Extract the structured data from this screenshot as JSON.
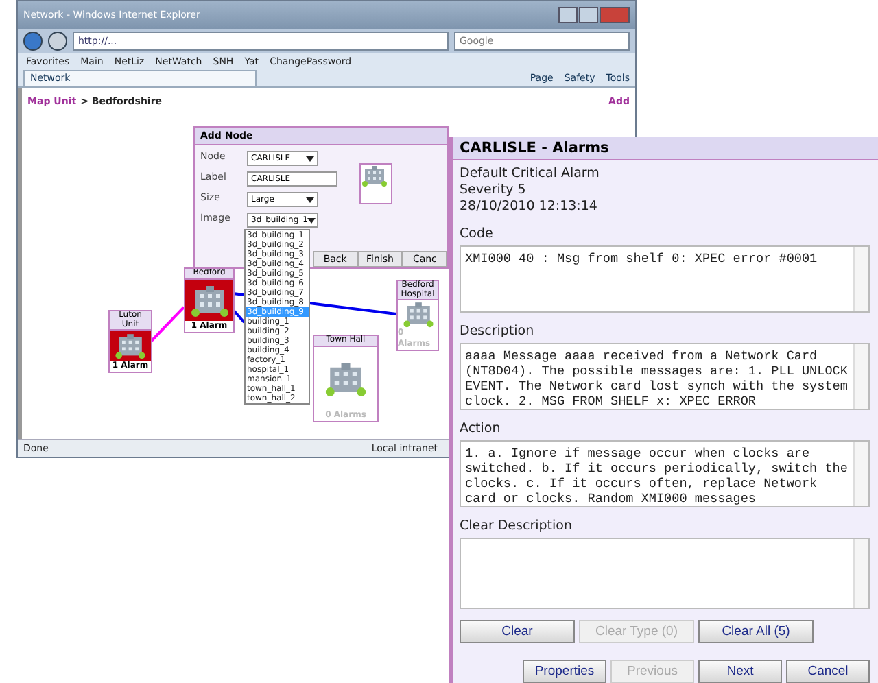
{
  "browser": {
    "title": "Network - Windows Internet Explorer",
    "address": "http://...",
    "search_placeholder": "Google",
    "favorites": [
      "Favorites",
      "Main",
      "NetLiz",
      "NetWatch",
      "SNH",
      "Yat",
      "ChangePassword"
    ],
    "tab": "Network",
    "commands": [
      "Page",
      "Safety",
      "Tools"
    ],
    "status": "Done",
    "zone": "Local intranet"
  },
  "page": {
    "breadcrumb_link": "Map Unit",
    "breadcrumb_current": "> Bedfordshire",
    "add_link": "Add"
  },
  "map": {
    "nodes": [
      {
        "label": "Bedford",
        "alarms": "1 Alarm",
        "alarmed": true,
        "kind": "large"
      },
      {
        "label": "Luton Unit",
        "alarms": "1 Alarm",
        "alarmed": true,
        "kind": "small"
      },
      {
        "label": "Town Hall",
        "alarms": "0 Alarms",
        "alarmed": false,
        "kind": "wide"
      },
      {
        "label": "Bedford Hospital",
        "alarms": "0 Alarms",
        "alarmed": false,
        "kind": "tall"
      }
    ]
  },
  "add_node": {
    "title": "Add Node",
    "fields": [
      {
        "label": "Node",
        "value": "CARLISLE",
        "kind": "select"
      },
      {
        "label": "Label",
        "value": "CARLISLE",
        "kind": "text"
      },
      {
        "label": "Size",
        "value": "Large",
        "kind": "select"
      },
      {
        "label": "Image",
        "value": "3d_building_1",
        "kind": "select"
      }
    ],
    "options": [
      {
        "text": "3d_building_1",
        "selected": false
      },
      {
        "text": "3d_building_2",
        "selected": false
      },
      {
        "text": "3d_building_3",
        "selected": false
      },
      {
        "text": "3d_building_4",
        "selected": false
      },
      {
        "text": "3d_building_5",
        "selected": false
      },
      {
        "text": "3d_building_6",
        "selected": false
      },
      {
        "text": "3d_building_7",
        "selected": false
      },
      {
        "text": "3d_building_8",
        "selected": false
      },
      {
        "text": "3d_building_9",
        "selected": true
      },
      {
        "text": "building_1",
        "selected": false
      },
      {
        "text": "building_2",
        "selected": false
      },
      {
        "text": "building_3",
        "selected": false
      },
      {
        "text": "building_4",
        "selected": false
      },
      {
        "text": "factory_1",
        "selected": false
      },
      {
        "text": "hospital_1",
        "selected": false
      },
      {
        "text": "mansion_1",
        "selected": false
      },
      {
        "text": "town_hall_1",
        "selected": false
      },
      {
        "text": "town_hall_2",
        "selected": false
      }
    ],
    "buttons": [
      "Back",
      "Finish",
      "Canc"
    ]
  },
  "alarms": {
    "title": "CARLISLE - Alarms",
    "info": [
      "Default Critical Alarm",
      "Severity 5",
      "28/10/2010 12:13:14"
    ],
    "sections": [
      {
        "label": "Code",
        "text": "XMI000 40 : Msg from shelf 0: XPEC error #0001"
      },
      {
        "label": "Description",
        "text": "aaaa Message aaaa received from a Network Card (NT8D04). The possible messages are: 1. PLL UNLOCK EVENT. The Network card lost synch with the system clock. 2. MSG FROM SHELF x: XPEC ERROR"
      },
      {
        "label": "Action",
        "text": "1. a. Ignore if message occur when clocks are switched. b. If it occurs periodically, switch the clocks. c. If it occurs often, replace Network card or clocks. Random XMI000 messages"
      },
      {
        "label": "Clear Description"
      }
    ],
    "clear_buttons": [
      {
        "label": "Clear",
        "disabled": false
      },
      {
        "label": "Clear Type (0)",
        "disabled": true
      },
      {
        "label": "Clear All (5)",
        "disabled": false
      }
    ],
    "nav_buttons": [
      {
        "label": "Properties",
        "disabled": false
      },
      {
        "label": "Previous",
        "disabled": true
      },
      {
        "label": "Next",
        "disabled": false
      },
      {
        "label": "Cancel",
        "disabled": false
      }
    ]
  }
}
